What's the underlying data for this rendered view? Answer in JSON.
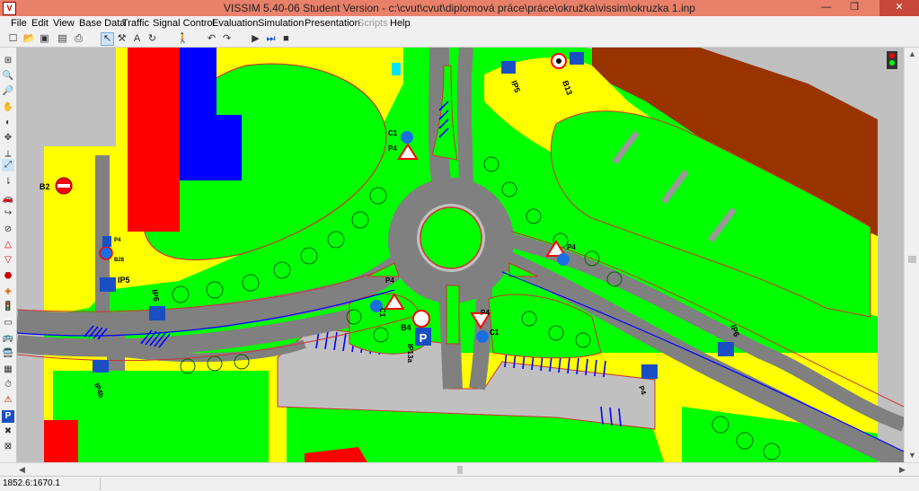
{
  "window": {
    "title": "VISSIM 5.40-06 Student Version - c:\\cvut\\cvut\\diplomová práce\\práce\\okružka\\vissim\\okruzka 1.inp",
    "app_icon_label": "V",
    "minimize": "—",
    "restore": "❐",
    "close": "✕"
  },
  "menu": {
    "file": "File",
    "edit": "Edit",
    "view": "View",
    "base_data": "Base Data",
    "traffic": "Traffic",
    "signal_control": "Signal Control",
    "evaluation": "Evaluation",
    "simulation": "Simulation",
    "presentation": "Presentation",
    "scripts": "Scripts",
    "help": "Help"
  },
  "map_labels": {
    "ip5_left": "IP5",
    "ip5_top": "IP5",
    "ip6_left": "IP6",
    "ip6_right": "IP6",
    "b2": "B2",
    "b13": "B13",
    "b4": "B4",
    "c1_a": "C1",
    "c1_b": "C1",
    "c1_c": "C1",
    "p4_a": "P4",
    "p4_b": "P4",
    "p4_c": "P4",
    "p4_d": "P4",
    "ip13a": "IP13a",
    "ip4b": "IP4b",
    "b28": "B28",
    "p4_e": "P4",
    "p4_f": "P4"
  },
  "status": {
    "coordinates": "1852.6:1670.1"
  },
  "colors": {
    "grass": "#00ff00",
    "road": "#808080",
    "yellow": "#ffff00",
    "building_red": "#ff0000",
    "building_blue": "#0000ff",
    "brown": "#993300",
    "titlebar": "#e8806a"
  }
}
